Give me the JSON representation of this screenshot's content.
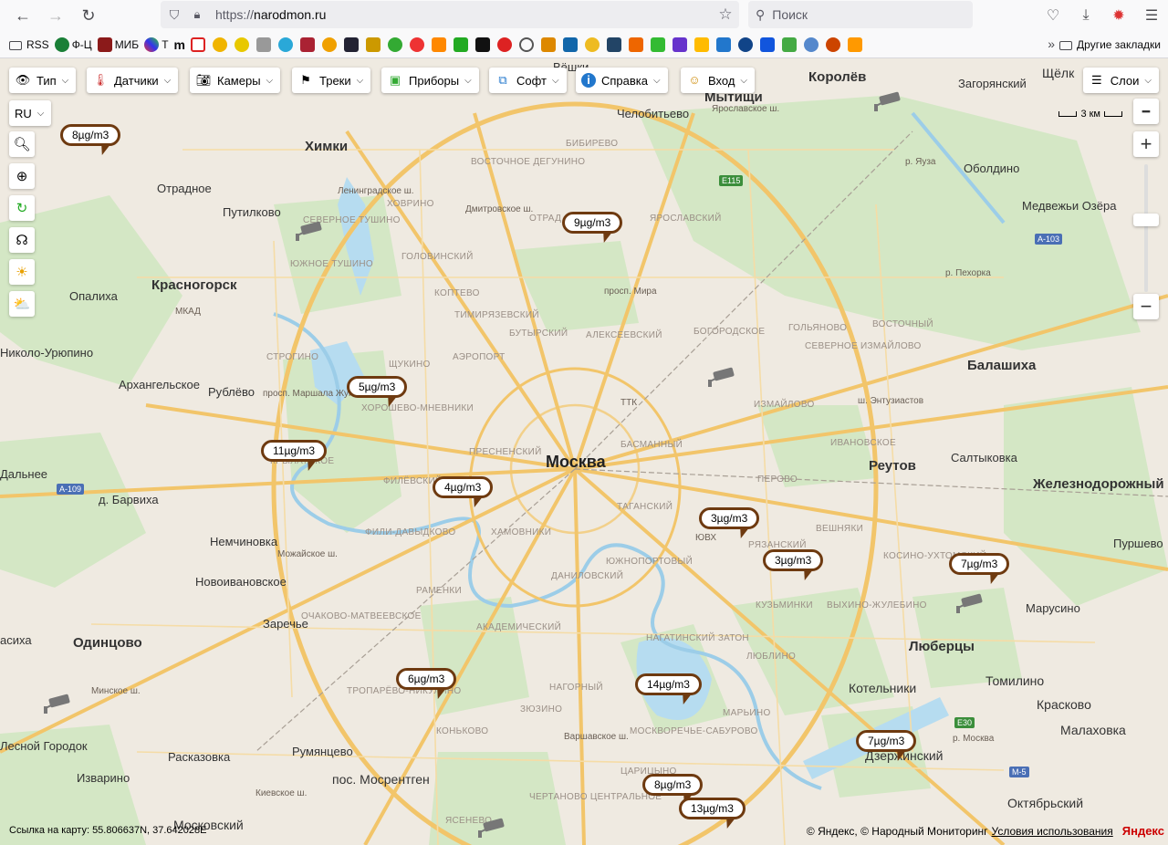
{
  "browser": {
    "url_prefix": "https://",
    "url_host": "narodmon.ru",
    "search_placeholder": "Поиск",
    "bookmarks": [
      "RSS",
      "Ф-Ц",
      "МИБ",
      "T",
      "m"
    ],
    "other_bookmarks": "Другие закладки"
  },
  "toolbar": {
    "items": [
      {
        "label": "Тип",
        "icon": "eye-icon"
      },
      {
        "label": "Датчики",
        "icon": "thermometer-icon"
      },
      {
        "label": "Камеры",
        "icon": "camera-icon"
      },
      {
        "label": "Треки",
        "icon": "flag-icon"
      },
      {
        "label": "Приборы",
        "icon": "device-icon"
      },
      {
        "label": "Софт",
        "icon": "windows-icon"
      },
      {
        "label": "Справка",
        "icon": "info-icon"
      },
      {
        "label": "Вход",
        "icon": "login-icon"
      }
    ],
    "layers_label": "Слои",
    "language": "RU",
    "scale_label": "3 км"
  },
  "map": {
    "labels": [
      {
        "text": "Химки",
        "type": "big"
      },
      {
        "text": "Москва",
        "type": "city"
      },
      {
        "text": "Красногорск",
        "type": "big"
      },
      {
        "text": "Мытищи",
        "type": "big"
      },
      {
        "text": "Королёв",
        "type": "big"
      },
      {
        "text": "Балашиха",
        "type": "big"
      },
      {
        "text": "Реутов",
        "type": "big"
      },
      {
        "text": "Люберцы",
        "type": "big"
      },
      {
        "text": "Одинцово",
        "type": "big"
      },
      {
        "text": "Железнодорожный",
        "type": "big"
      },
      {
        "text": "Дзержинский",
        "type": "town"
      },
      {
        "text": "Котельники",
        "type": "town"
      },
      {
        "text": "Томилино",
        "type": "town"
      },
      {
        "text": "Красково",
        "type": "town"
      },
      {
        "text": "Малаховка",
        "type": "town"
      },
      {
        "text": "Октябрьский",
        "type": "town"
      },
      {
        "text": "пос. Мосрентген",
        "type": "town"
      },
      {
        "text": "Московский",
        "type": "town"
      },
      {
        "text": "Щёлк",
        "type": "town"
      },
      {
        "text": "Загорянский",
        "type": "small"
      },
      {
        "text": "Оболдино",
        "type": "small"
      },
      {
        "text": "Медвежьи Озёра",
        "type": "small"
      },
      {
        "text": "Салтыковка",
        "type": "small"
      },
      {
        "text": "Пуршево",
        "type": "small"
      },
      {
        "text": "Марусино",
        "type": "small"
      },
      {
        "text": "Челобитьево",
        "type": "small"
      },
      {
        "text": "Отрадное",
        "type": "small"
      },
      {
        "text": "Путилково",
        "type": "small"
      },
      {
        "text": "Опалиха",
        "type": "small"
      },
      {
        "text": "Архангельское",
        "type": "small"
      },
      {
        "text": "Рублёво",
        "type": "small"
      },
      {
        "text": "Николо-Урюпино",
        "type": "small"
      },
      {
        "text": "Дальнее",
        "type": "small"
      },
      {
        "text": "д. Барвиха",
        "type": "small"
      },
      {
        "text": "Немчиновка",
        "type": "small"
      },
      {
        "text": "Новоивановское",
        "type": "small"
      },
      {
        "text": "Заречье",
        "type": "small"
      },
      {
        "text": "Расказовка",
        "type": "small"
      },
      {
        "text": "Изварино",
        "type": "small"
      },
      {
        "text": "Румянцево",
        "type": "small"
      },
      {
        "text": "Лесной Городок",
        "type": "small"
      },
      {
        "text": "асиха",
        "type": "small"
      },
      {
        "text": "Вёшки",
        "type": "small"
      },
      {
        "text": "ХОВРИНО",
        "type": "district"
      },
      {
        "text": "ВОСТОЧНОЕ ДЕГУНИНО",
        "type": "district"
      },
      {
        "text": "БИБИРЕВО",
        "type": "district"
      },
      {
        "text": "ОТРАД",
        "type": "district"
      },
      {
        "text": "ЯРОСЛАВСКИЙ",
        "type": "district"
      },
      {
        "text": "СЕВЕРНОЕ ТУШИНО",
        "type": "district"
      },
      {
        "text": "ЮЖНОЕ ТУШИНО",
        "type": "district"
      },
      {
        "text": "ГОЛОВИНСКИЙ",
        "type": "district"
      },
      {
        "text": "КОПТЕВО",
        "type": "district"
      },
      {
        "text": "ТИМИРЯЗЕВСКИЙ",
        "type": "district"
      },
      {
        "text": "БУТЫРСКИЙ",
        "type": "district"
      },
      {
        "text": "АЛЕКСЕЕВСКИЙ",
        "type": "district"
      },
      {
        "text": "БОГОРОДСКОЕ",
        "type": "district"
      },
      {
        "text": "ГОЛЬЯНОВО",
        "type": "district"
      },
      {
        "text": "СЕВЕРНОЕ ИЗМАЙЛОВО",
        "type": "district"
      },
      {
        "text": "ВОСТОЧНЫЙ",
        "type": "district"
      },
      {
        "text": "ИЗМАЙЛОВО",
        "type": "district"
      },
      {
        "text": "ИВАНОВСКОЕ",
        "type": "district"
      },
      {
        "text": "ПЕРОВО",
        "type": "district"
      },
      {
        "text": "СТРОГИНО",
        "type": "district"
      },
      {
        "text": "ЩУКИНО",
        "type": "district"
      },
      {
        "text": "АЭРОПОРТ",
        "type": "district"
      },
      {
        "text": "ХОРОШЕВО-МНЕВНИКИ",
        "type": "district"
      },
      {
        "text": "КРЫЛАТСКОЕ",
        "type": "district"
      },
      {
        "text": "ПРЕСНЕНСКИЙ",
        "type": "district"
      },
      {
        "text": "БАСМАННЫЙ",
        "type": "district"
      },
      {
        "text": "ТАГАНСКИЙ",
        "type": "district"
      },
      {
        "text": "ФИЛЁВСКИЙ ПАРК",
        "type": "district"
      },
      {
        "text": "ФИЛИ-ДАВЫДКОВО",
        "type": "district"
      },
      {
        "text": "ХАМОВНИКИ",
        "type": "district"
      },
      {
        "text": "ЮЖНОПОРТОВЫЙ",
        "type": "district"
      },
      {
        "text": "ДАНИЛОВСКИЙ",
        "type": "district"
      },
      {
        "text": "РЯЗАНСКИЙ",
        "type": "district"
      },
      {
        "text": "ВЕШНЯКИ",
        "type": "district"
      },
      {
        "text": "КОСИНО-УХТОМСКИЙ",
        "type": "district"
      },
      {
        "text": "КУЗЬМИНКИ",
        "type": "district"
      },
      {
        "text": "ВЫХИНО-ЖУЛЕБИНО",
        "type": "district"
      },
      {
        "text": "ЛЮБЛИНО",
        "type": "district"
      },
      {
        "text": "РАМЕНКИ",
        "type": "district"
      },
      {
        "text": "АКАДЕМИЧЕСКИЙ",
        "type": "district"
      },
      {
        "text": "НАГАТИНСКИЙ ЗАТОН",
        "type": "district"
      },
      {
        "text": "ОЧАКОВО-МАТВЕЕВСКОЕ",
        "type": "district"
      },
      {
        "text": "ТРОПАРЁВО-НИКУЛИНО",
        "type": "district"
      },
      {
        "text": "ЗЮЗИНО",
        "type": "district"
      },
      {
        "text": "НАГОРНЫЙ",
        "type": "district"
      },
      {
        "text": "МАРЬИНО",
        "type": "district"
      },
      {
        "text": "КОНЬКОВО",
        "type": "district"
      },
      {
        "text": "МОСКВОРЕЧЬЕ-САБУРОВО",
        "type": "district"
      },
      {
        "text": "ЦАРИЦЫНО",
        "type": "district"
      },
      {
        "text": "ЧЕРТАНОВО ЦЕНТРАЛЬНОЕ",
        "type": "district"
      },
      {
        "text": "ЯСЕНЕВО",
        "type": "district"
      },
      {
        "text": "МКАД",
        "type": "road"
      },
      {
        "text": "Ленинградское ш.",
        "type": "road"
      },
      {
        "text": "Дмитровское ш.",
        "type": "road"
      },
      {
        "text": "Ярославское ш.",
        "type": "road"
      },
      {
        "text": "просп. Мира",
        "type": "road"
      },
      {
        "text": "ш. Энтузиастов",
        "type": "road"
      },
      {
        "text": "Можайское ш.",
        "type": "road"
      },
      {
        "text": "Минское ш.",
        "type": "road"
      },
      {
        "text": "Варшавское ш.",
        "type": "road"
      },
      {
        "text": "Киевское ш.",
        "type": "road"
      },
      {
        "text": "просп. Маршала Жукова",
        "type": "road"
      },
      {
        "text": "ТТК",
        "type": "road"
      },
      {
        "text": "ЮВХ",
        "type": "road"
      },
      {
        "text": "р. Яуза",
        "type": "road"
      },
      {
        "text": "р. Пехорка",
        "type": "road"
      },
      {
        "text": "р. Москва",
        "type": "road"
      },
      {
        "text": "E115",
        "type": "shield"
      },
      {
        "text": "A-103",
        "type": "shield"
      },
      {
        "text": "A-109",
        "type": "shield"
      },
      {
        "text": "E30",
        "type": "shield"
      },
      {
        "text": "M-5",
        "type": "shield"
      }
    ],
    "markers": [
      {
        "value": "8µg/m3"
      },
      {
        "value": "9µg/m3"
      },
      {
        "value": "5µg/m3"
      },
      {
        "value": "11µg/m3"
      },
      {
        "value": "4µg/m3"
      },
      {
        "value": "3µg/m3"
      },
      {
        "value": "3µg/m3"
      },
      {
        "value": "7µg/m3"
      },
      {
        "value": "6µg/m3"
      },
      {
        "value": "14µg/m3"
      },
      {
        "value": "7µg/m3"
      },
      {
        "value": "8µg/m3"
      },
      {
        "value": "13µg/m3"
      }
    ],
    "coords_text": "Ссылка на карту: 55.806637N, 37.642028E",
    "copyright_text": "© Яндекс, © Народный Мониторинг",
    "terms_link": "Условия использования",
    "yandex_logo": "Яндекс"
  }
}
